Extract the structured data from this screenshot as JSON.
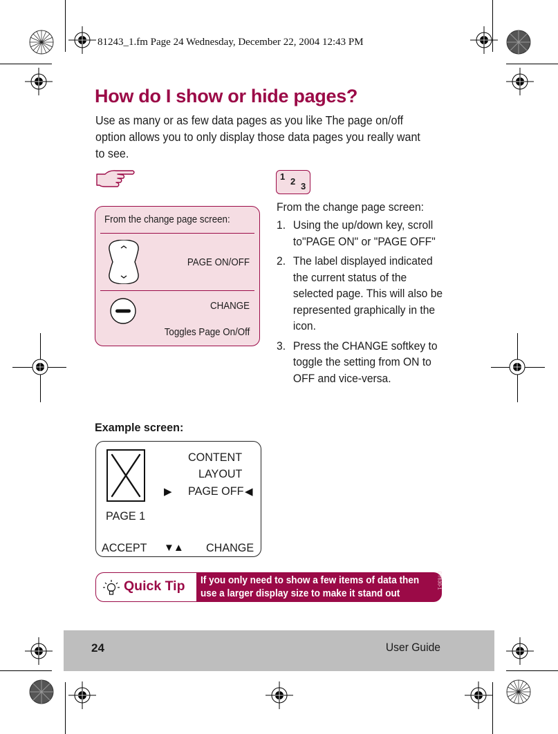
{
  "print_slug": "81243_1.fm  Page 24  Wednesday, December 22, 2004  12:43 PM",
  "title": "How do I show or hide pages?",
  "intro": "Use as many or as few data pages as you like The page on/off option allows you to only display those data pages you really want to see.",
  "colors": {
    "accent": "#9b0a47",
    "panel_bg": "#f5dde3",
    "footer_bg": "#bebebe"
  },
  "key_panel": {
    "icon": "pointing-hand-icon",
    "heading": "From the change page screen:",
    "rows": [
      {
        "icon": "up-down-key-icon",
        "label": "PAGE ON/OFF"
      },
      {
        "icon": "softkey-minus-icon",
        "label": "CHANGE",
        "description": "Toggles Page On/Off"
      }
    ]
  },
  "steps_panel": {
    "icon": "numbered-steps-icon",
    "icon_digits": [
      "1",
      "2",
      "3"
    ],
    "heading": "From the change page screen:",
    "steps": [
      {
        "num": "1.",
        "text": "Using the up/down key, scroll to\"PAGE ON\" or \"PAGE OFF\""
      },
      {
        "num": "2.",
        "text": "The label displayed indicated the current status of the selected page. This will also be represented graphically in the icon."
      },
      {
        "num": "3.",
        "text": "Press the CHANGE softkey to toggle the setting from ON to OFF and vice-versa."
      }
    ]
  },
  "example": {
    "label": "Example screen:",
    "page_icon": "page-off-x-icon",
    "page_label": "PAGE 1",
    "menu": [
      "CONTENT",
      "LAYOUT",
      "PAGE OFF"
    ],
    "selected_index": 2,
    "softkeys": {
      "left": "ACCEPT",
      "middle": "▼▲",
      "right": "CHANGE"
    }
  },
  "quick_tip": {
    "icon": "lightbulb-icon",
    "title": "Quick Tip",
    "text": "If you only need to show a few items of data then use a larger display size to make it stand out",
    "code": "D7630-1"
  },
  "footer": {
    "page_number": "24",
    "label": "User Guide"
  }
}
